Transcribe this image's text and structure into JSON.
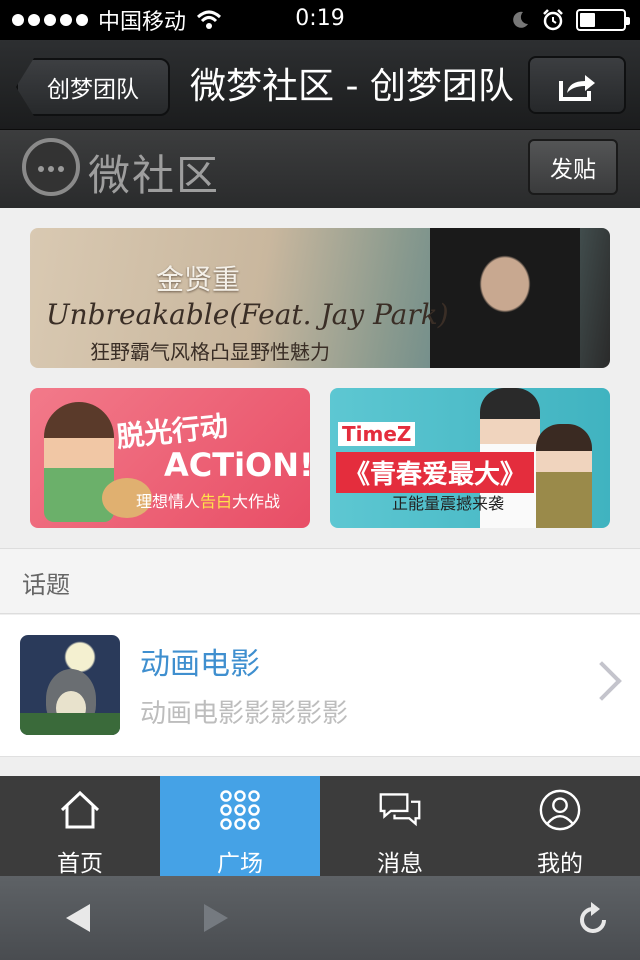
{
  "statusbar": {
    "carrier": "中国移动",
    "time": "0:19",
    "battery_level": 0.35,
    "icons": [
      "signal-dots-icon",
      "wifi-icon",
      "moon-icon",
      "alarm-icon",
      "battery-icon"
    ]
  },
  "navbar": {
    "back_label": "创梦团队",
    "title": "微梦社区 - 创梦团队",
    "share_icon": "share-icon"
  },
  "subheader": {
    "logo_text": "微社区",
    "post_button": "发贴"
  },
  "banners": {
    "main": {
      "title": "金贤重",
      "subtitle": "Unbreakable(Feat. Jay Park)",
      "desc": "狂野霸气风格凸显野性魅力"
    },
    "left": {
      "title": "脱光行动",
      "action": "ACTiON!",
      "sub_pre": "理想情人",
      "sub_highlight": "告白",
      "sub_post": "大作战"
    },
    "right": {
      "tag": "TimeZ",
      "title": "《青春爱最大》",
      "sub": "正能量震撼来袭"
    }
  },
  "section": {
    "title": "话题"
  },
  "topic": {
    "name": "动画电影",
    "desc": "动画电影影影影影"
  },
  "tabs": [
    {
      "label": "首页",
      "icon": "home-icon"
    },
    {
      "label": "广场",
      "icon": "grid-icon",
      "active": true
    },
    {
      "label": "消息",
      "icon": "chat-icon"
    },
    {
      "label": "我的",
      "icon": "profile-icon"
    }
  ],
  "browserbar": {
    "icons": [
      "back-icon",
      "forward-icon",
      "reload-icon"
    ]
  },
  "colors": {
    "accent": "#45a2e6",
    "topic_name": "#3f8fcf",
    "tabbar_bg": "#3c3c3c"
  }
}
